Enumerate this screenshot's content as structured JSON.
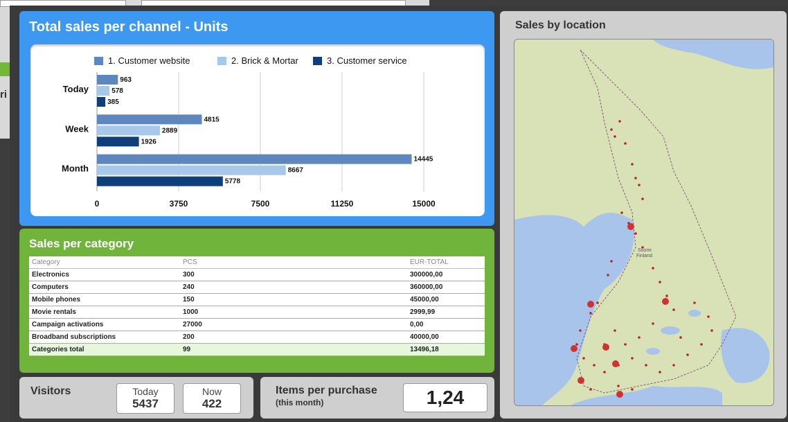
{
  "background_fragment": {
    "text": "ri"
  },
  "channel_panel": {
    "title": "Total sales per channel - Units"
  },
  "chart_data": {
    "type": "bar",
    "orientation": "horizontal",
    "categories": [
      "Today",
      "Week",
      "Month"
    ],
    "series": [
      {
        "name": "1. Customer website",
        "values": [
          963,
          4815,
          14445
        ],
        "color": "#5f87bf"
      },
      {
        "name": "2. Brick & Mortar",
        "values": [
          578,
          2889,
          8667
        ],
        "color": "#a8c8ea"
      },
      {
        "name": "3. Customer service",
        "values": [
          385,
          1926,
          5778
        ],
        "color": "#0f3f7a"
      }
    ],
    "xticks": [
      "0",
      "3750",
      "7500",
      "11250",
      "15000"
    ],
    "xlim": [
      0,
      15000
    ],
    "grid": true,
    "legend_position": "top"
  },
  "category_panel": {
    "title": "Sales per category",
    "columns": [
      "Category",
      "PCS",
      "EUR-TOTAL"
    ],
    "rows": [
      [
        "Electronics",
        "300",
        "300000,00"
      ],
      [
        "Computers",
        "240",
        "360000,00"
      ],
      [
        "Mobile phones",
        "150",
        "45000,00"
      ],
      [
        "Movie rentals",
        "1000",
        "2999,99"
      ],
      [
        "Campaign activations",
        "27000",
        "0,00"
      ],
      [
        "Broadband subscriptions",
        "200",
        "40000,00"
      ]
    ],
    "total": [
      "Categories total",
      "99",
      "13496,18"
    ]
  },
  "visitors": {
    "title": "Visitors",
    "today_label": "Today",
    "today_value": "5437",
    "now_label": "Now",
    "now_value": "422"
  },
  "items_per_purchase": {
    "title": "Items per purchase",
    "subtitle": "(this month)",
    "value": "1,24"
  },
  "location_panel": {
    "title": "Sales by location",
    "map_labels": [
      "Suomi",
      "Finland"
    ]
  }
}
